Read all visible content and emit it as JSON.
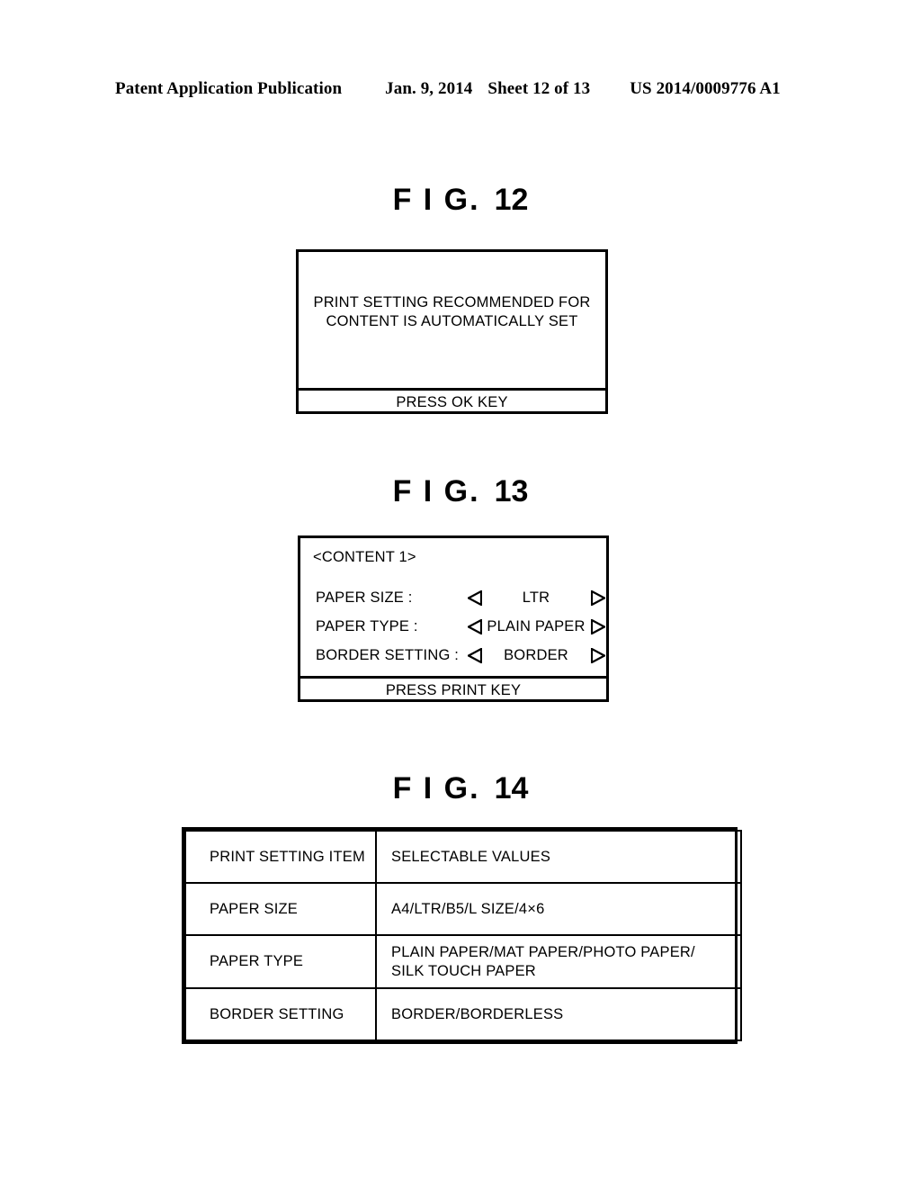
{
  "header": {
    "publication": "Patent Application Publication",
    "date": "Jan. 9, 2014",
    "sheet": "Sheet 12 of 13",
    "patent_number": "US 2014/0009776 A1"
  },
  "figures": {
    "fig12": {
      "title_prefix": "F I G.",
      "title_number": "12",
      "message_line1": "PRINT SETTING RECOMMENDED FOR",
      "message_line2": "CONTENT IS AUTOMATICALLY SET",
      "footer": "PRESS OK KEY"
    },
    "fig13": {
      "title_prefix": "F I G.",
      "title_number": "13",
      "content_label": "<CONTENT 1>",
      "rows": [
        {
          "label": "PAPER SIZE :",
          "value": "LTR",
          "left_arrow": "left-triangle-icon",
          "right_arrow": "right-triangle-icon"
        },
        {
          "label": "PAPER TYPE :",
          "value": "PLAIN PAPER",
          "left_arrow": "left-triangle-icon",
          "right_arrow": "right-triangle-icon"
        },
        {
          "label": "BORDER SETTING :",
          "value": "BORDER",
          "left_arrow": "left-triangle-icon",
          "right_arrow": "right-triangle-icon"
        }
      ],
      "footer": "PRESS PRINT KEY"
    },
    "fig14": {
      "title_prefix": "F I G.",
      "title_number": "14",
      "columns": [
        "PRINT SETTING ITEM",
        "SELECTABLE VALUES"
      ],
      "rows": [
        {
          "item": "PAPER SIZE",
          "values": "A4/LTR/B5/L SIZE/4×6"
        },
        {
          "item": "PAPER TYPE",
          "values_line1": "PLAIN PAPER/MAT PAPER/PHOTO PAPER/",
          "values_line2": "SILK TOUCH PAPER"
        },
        {
          "item": "BORDER SETTING",
          "values": "BORDER/BORDERLESS"
        }
      ]
    }
  },
  "colors": {
    "ink": "#000000",
    "paper": "#ffffff"
  }
}
